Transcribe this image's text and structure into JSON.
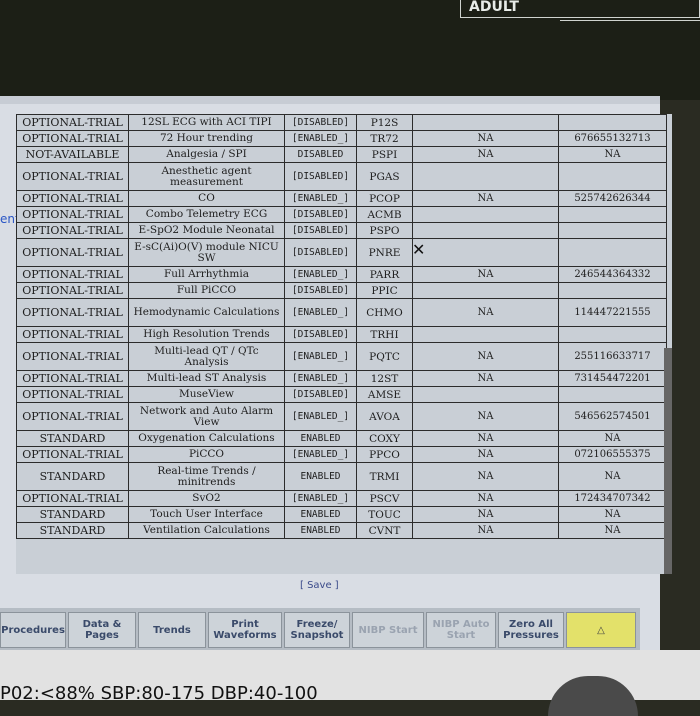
{
  "top_display": {
    "label": "ADULT"
  },
  "side_link": "ent",
  "table": {
    "rows": [
      {
        "status": "OPTIONAL-TRIAL",
        "feature": "12SL ECG with ACI TIPI",
        "config": "[DISABLED]",
        "code": "P12S",
        "col5": "",
        "col6": ""
      },
      {
        "status": "OPTIONAL-TRIAL",
        "feature": "72 Hour trending",
        "config": "[ENABLED_]",
        "code": "TR72",
        "col5": "NA",
        "col6": "676655132713"
      },
      {
        "status": "NOT-AVAILABLE",
        "feature": "Analgesia / SPI",
        "config": "DISABLED",
        "code": "PSPI",
        "col5": "NA",
        "col6": "NA"
      },
      {
        "status": "OPTIONAL-TRIAL",
        "feature": "Anesthetic agent measurement",
        "config": "[DISABLED]",
        "code": "PGAS",
        "col5": "",
        "col6": ""
      },
      {
        "status": "OPTIONAL-TRIAL",
        "feature": "CO",
        "config": "[ENABLED_]",
        "code": "PCOP",
        "col5": "NA",
        "col6": "525742626344"
      },
      {
        "status": "OPTIONAL-TRIAL",
        "feature": "Combo Telemetry ECG",
        "config": "[DISABLED]",
        "code": "ACMB",
        "col5": "",
        "col6": ""
      },
      {
        "status": "OPTIONAL-TRIAL",
        "feature": "E-SpO2 Module Neonatal",
        "config": "[DISABLED]",
        "code": "PSPO",
        "col5": "",
        "col6": ""
      },
      {
        "status": "OPTIONAL-TRIAL",
        "feature": "E-sC(Ai)O(V) module NICU SW",
        "config": "[DISABLED]",
        "code": "PNRE",
        "col5": "",
        "col6": ""
      },
      {
        "status": "OPTIONAL-TRIAL",
        "feature": "Full Arrhythmia",
        "config": "[ENABLED_]",
        "code": "PARR",
        "col5": "NA",
        "col6": "246544364332"
      },
      {
        "status": "OPTIONAL-TRIAL",
        "feature": "Full PiCCO",
        "config": "[DISABLED]",
        "code": "PPIC",
        "col5": "",
        "col6": ""
      },
      {
        "status": "OPTIONAL-TRIAL",
        "feature": "Hemodynamic Calculations",
        "config": "[ENABLED_]",
        "code": "CHMO",
        "col5": "NA",
        "col6": "114447221555"
      },
      {
        "status": "OPTIONAL-TRIAL",
        "feature": "High Resolution Trends",
        "config": "[DISABLED]",
        "code": "TRHI",
        "col5": "",
        "col6": ""
      },
      {
        "status": "OPTIONAL-TRIAL",
        "feature": "Multi-lead QT / QTc Analysis",
        "config": "[ENABLED_]",
        "code": "PQTC",
        "col5": "NA",
        "col6": "255116633717"
      },
      {
        "status": "OPTIONAL-TRIAL",
        "feature": "Multi-lead ST Analysis",
        "config": "[ENABLED_]",
        "code": "12ST",
        "col5": "NA",
        "col6": "731454472201"
      },
      {
        "status": "OPTIONAL-TRIAL",
        "feature": "MuseView",
        "config": "[DISABLED]",
        "code": "AMSE",
        "col5": "",
        "col6": ""
      },
      {
        "status": "OPTIONAL-TRIAL",
        "feature": "Network and Auto Alarm View",
        "config": "[ENABLED_]",
        "code": "AVOA",
        "col5": "NA",
        "col6": "546562574501"
      },
      {
        "status": "STANDARD",
        "feature": "Oxygenation Calculations",
        "config": "ENABLED",
        "code": "COXY",
        "col5": "NA",
        "col6": "NA"
      },
      {
        "status": "OPTIONAL-TRIAL",
        "feature": "PiCCO",
        "config": "[ENABLED_]",
        "code": "PPCO",
        "col5": "NA",
        "col6": "072106555375"
      },
      {
        "status": "STANDARD",
        "feature": "Real-time Trends / minitrends",
        "config": "ENABLED",
        "code": "TRMI",
        "col5": "NA",
        "col6": "NA"
      },
      {
        "status": "OPTIONAL-TRIAL",
        "feature": "SvO2",
        "config": "[ENABLED_]",
        "code": "PSCV",
        "col5": "NA",
        "col6": "172434707342"
      },
      {
        "status": "STANDARD",
        "feature": "Touch User Interface",
        "config": "ENABLED",
        "code": "TOUC",
        "col5": "NA",
        "col6": "NA"
      },
      {
        "status": "STANDARD",
        "feature": "Ventilation Calculations",
        "config": "ENABLED",
        "code": "CVNT",
        "col5": "NA",
        "col6": "NA"
      }
    ]
  },
  "save_label": "[ Save ]",
  "buttons": [
    {
      "label": "Procedures",
      "enabled": true
    },
    {
      "label": "Data & Pages",
      "enabled": true
    },
    {
      "label": "Trends",
      "enabled": true
    },
    {
      "label": "Print Waveforms",
      "enabled": true
    },
    {
      "label": "Freeze/ Snapshot",
      "enabled": true
    },
    {
      "label": "NIBP Start",
      "enabled": false
    },
    {
      "label": "NIBP Auto Start",
      "enabled": false
    },
    {
      "label": "Zero All Pressures",
      "enabled": true
    },
    {
      "label": "△",
      "enabled": true
    }
  ],
  "bezel_text": "P02:<88% SBP:80-175 DBP:40-100"
}
